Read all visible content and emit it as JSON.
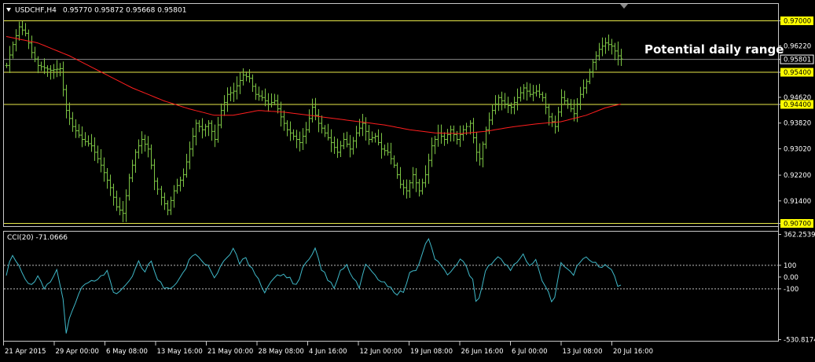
{
  "header": {
    "menu_icon": "triangle-down-icon",
    "symbol_timeframe": "USDCHF,H4",
    "ohlc": "0.95770 0.95872 0.95668 0.95801"
  },
  "annotation": "Potential daily range",
  "colors": {
    "background": "#000000",
    "candles": "#7cc444",
    "moving_average": "#ff1e1e",
    "level_lines": "#e8e84a",
    "level_label_bg": "#ffff00",
    "current_price_line": "#8a8a8a",
    "cci_line": "#3fb8c8",
    "frame": "#c8c8c8"
  },
  "chart_data": [
    {
      "type": "ohlc",
      "title": "USDCHF,H4",
      "ylim": [
        0.907,
        0.97
      ],
      "y_ticks": [
        "0.97000",
        "0.96220",
        "0.95801",
        "0.95400",
        "0.94620",
        "0.94400",
        "0.93820",
        "0.93020",
        "0.92200",
        "0.91400",
        "0.90700"
      ],
      "highlighted_levels": [
        {
          "label": "0.97000",
          "value": 0.97
        },
        {
          "label": "0.95400",
          "value": 0.954
        },
        {
          "label": "0.94400",
          "value": 0.944
        },
        {
          "label": "0.90700",
          "value": 0.907
        }
      ],
      "current_price": {
        "label": "0.95801",
        "value": 0.95801
      },
      "x_ticks": [
        "21 Apr 2015",
        "29 Apr 00:00",
        "6 May 08:00",
        "13 May 16:00",
        "21 May 00:00",
        "28 May 08:00",
        "4 Jun 16:00",
        "12 Jun 00:00",
        "19 Jun 08:00",
        "26 Jun 16:00",
        "6 Jul 00:00",
        "13 Jul 08:00",
        "20 Jul 16:00"
      ],
      "bar_count": 196,
      "close_anchors": [
        [
          0,
          0.956
        ],
        [
          2,
          0.9625
        ],
        [
          4,
          0.968
        ],
        [
          6,
          0.966
        ],
        [
          8,
          0.96
        ],
        [
          10,
          0.956
        ],
        [
          14,
          0.9545
        ],
        [
          17,
          0.955
        ],
        [
          19,
          0.942
        ],
        [
          21,
          0.937
        ],
        [
          24,
          0.933
        ],
        [
          27,
          0.931
        ],
        [
          30,
          0.925
        ],
        [
          33,
          0.918
        ],
        [
          35,
          0.912
        ],
        [
          37,
          0.91
        ],
        [
          39,
          0.921
        ],
        [
          41,
          0.929
        ],
        [
          43,
          0.933
        ],
        [
          45,
          0.93
        ],
        [
          47,
          0.92
        ],
        [
          49,
          0.915
        ],
        [
          51,
          0.911
        ],
        [
          53,
          0.917
        ],
        [
          56,
          0.922
        ],
        [
          58,
          0.93
        ],
        [
          60,
          0.938
        ],
        [
          62,
          0.936
        ],
        [
          64,
          0.938
        ],
        [
          66,
          0.933
        ],
        [
          68,
          0.942
        ],
        [
          70,
          0.947
        ],
        [
          72,
          0.948
        ],
        [
          75,
          0.953
        ],
        [
          77,
          0.952
        ],
        [
          79,
          0.947
        ],
        [
          81,
          0.946
        ],
        [
          83,
          0.944
        ],
        [
          85,
          0.945
        ],
        [
          87,
          0.94
        ],
        [
          89,
          0.936
        ],
        [
          91,
          0.934
        ],
        [
          93,
          0.932
        ],
        [
          95,
          0.936
        ],
        [
          97,
          0.943
        ],
        [
          99,
          0.938
        ],
        [
          101,
          0.935
        ],
        [
          103,
          0.932
        ],
        [
          105,
          0.929
        ],
        [
          107,
          0.933
        ],
        [
          109,
          0.93
        ],
        [
          111,
          0.935
        ],
        [
          113,
          0.938
        ],
        [
          115,
          0.933
        ],
        [
          117,
          0.934
        ],
        [
          119,
          0.93
        ],
        [
          121,
          0.929
        ],
        [
          123,
          0.925
        ],
        [
          125,
          0.919
        ],
        [
          127,
          0.917
        ],
        [
          129,
          0.922
        ],
        [
          131,
          0.917
        ],
        [
          133,
          0.922
        ],
        [
          135,
          0.931
        ],
        [
          137,
          0.935
        ],
        [
          139,
          0.933
        ],
        [
          141,
          0.936
        ],
        [
          143,
          0.933
        ],
        [
          145,
          0.936
        ],
        [
          147,
          0.938
        ],
        [
          149,
          0.929
        ],
        [
          150,
          0.927
        ],
        [
          152,
          0.936
        ],
        [
          154,
          0.942
        ],
        [
          156,
          0.946
        ],
        [
          158,
          0.944
        ],
        [
          160,
          0.943
        ],
        [
          162,
          0.946
        ],
        [
          164,
          0.949
        ],
        [
          166,
          0.947
        ],
        [
          168,
          0.948
        ],
        [
          170,
          0.946
        ],
        [
          172,
          0.94
        ],
        [
          174,
          0.937
        ],
        [
          176,
          0.946
        ],
        [
          178,
          0.944
        ],
        [
          180,
          0.941
        ],
        [
          182,
          0.947
        ],
        [
          184,
          0.951
        ],
        [
          186,
          0.957
        ],
        [
          188,
          0.961
        ],
        [
          190,
          0.963
        ],
        [
          192,
          0.962
        ],
        [
          194,
          0.959
        ],
        [
          195,
          0.95801
        ]
      ],
      "moving_average": [
        [
          0,
          0.965
        ],
        [
          10,
          0.963
        ],
        [
          20,
          0.959
        ],
        [
          30,
          0.954
        ],
        [
          40,
          0.949
        ],
        [
          50,
          0.945
        ],
        [
          58,
          0.9425
        ],
        [
          66,
          0.9405
        ],
        [
          72,
          0.9405
        ],
        [
          80,
          0.942
        ],
        [
          88,
          0.9415
        ],
        [
          96,
          0.9405
        ],
        [
          104,
          0.9395
        ],
        [
          112,
          0.9385
        ],
        [
          120,
          0.9375
        ],
        [
          128,
          0.936
        ],
        [
          136,
          0.935
        ],
        [
          144,
          0.9348
        ],
        [
          152,
          0.9355
        ],
        [
          160,
          0.9368
        ],
        [
          168,
          0.9378
        ],
        [
          176,
          0.9385
        ],
        [
          184,
          0.9405
        ],
        [
          190,
          0.9428
        ],
        [
          195,
          0.944
        ]
      ]
    },
    {
      "type": "line",
      "title": "CCI(20) -71.0666",
      "ylim": [
        -530.8174,
        362.2539
      ],
      "y_ticks": [
        "362.2539",
        "100",
        "0.00",
        "-100",
        "-530.8174"
      ],
      "reference_levels": [
        100,
        0,
        -100
      ],
      "series": [
        {
          "name": "CCI(20)",
          "points": [
            [
              0,
              30
            ],
            [
              2,
              200
            ],
            [
              4,
              100
            ],
            [
              6,
              -40
            ],
            [
              8,
              -80
            ],
            [
              10,
              20
            ],
            [
              12,
              -120
            ],
            [
              14,
              -40
            ],
            [
              16,
              60
            ],
            [
              18,
              -200
            ],
            [
              19,
              -480
            ],
            [
              20,
              -360
            ],
            [
              22,
              -200
            ],
            [
              24,
              -100
            ],
            [
              26,
              -60
            ],
            [
              28,
              -20
            ],
            [
              30,
              0
            ],
            [
              32,
              50
            ],
            [
              34,
              -120
            ],
            [
              36,
              -140
            ],
            [
              38,
              -60
            ],
            [
              40,
              20
            ],
            [
              42,
              120
            ],
            [
              44,
              60
            ],
            [
              46,
              150
            ],
            [
              48,
              -40
            ],
            [
              50,
              -80
            ],
            [
              52,
              -110
            ],
            [
              54,
              -40
            ],
            [
              56,
              40
            ],
            [
              58,
              130
            ],
            [
              60,
              200
            ],
            [
              62,
              120
            ],
            [
              64,
              80
            ],
            [
              66,
              -10
            ],
            [
              68,
              80
            ],
            [
              70,
              150
            ],
            [
              72,
              240
            ],
            [
              74,
              120
            ],
            [
              76,
              160
            ],
            [
              78,
              60
            ],
            [
              80,
              -20
            ],
            [
              82,
              -120
            ],
            [
              84,
              -60
            ],
            [
              86,
              0
            ],
            [
              88,
              40
            ],
            [
              90,
              -20
            ],
            [
              92,
              -80
            ],
            [
              94,
              60
            ],
            [
              96,
              140
            ],
            [
              98,
              240
            ],
            [
              100,
              60
            ],
            [
              102,
              -20
            ],
            [
              104,
              -100
            ],
            [
              106,
              40
            ],
            [
              108,
              100
            ],
            [
              110,
              0
            ],
            [
              112,
              -80
            ],
            [
              114,
              120
            ],
            [
              116,
              60
            ],
            [
              118,
              -40
            ],
            [
              120,
              -60
            ],
            [
              122,
              -80
            ],
            [
              124,
              -150
            ],
            [
              126,
              -120
            ],
            [
              128,
              20
            ],
            [
              130,
              60
            ],
            [
              132,
              200
            ],
            [
              134,
              340
            ],
            [
              136,
              150
            ],
            [
              138,
              80
            ],
            [
              140,
              30
            ],
            [
              142,
              80
            ],
            [
              144,
              150
            ],
            [
              146,
              70
            ],
            [
              148,
              -30
            ],
            [
              149,
              -200
            ],
            [
              150,
              -180
            ],
            [
              152,
              40
            ],
            [
              154,
              120
            ],
            [
              156,
              180
            ],
            [
              158,
              100
            ],
            [
              160,
              60
            ],
            [
              162,
              140
            ],
            [
              164,
              200
            ],
            [
              166,
              80
            ],
            [
              168,
              150
            ],
            [
              170,
              -20
            ],
            [
              172,
              -120
            ],
            [
              173,
              -230
            ],
            [
              174,
              -160
            ],
            [
              176,
              100
            ],
            [
              178,
              80
            ],
            [
              180,
              20
            ],
            [
              182,
              120
            ],
            [
              184,
              160
            ],
            [
              186,
              120
            ],
            [
              188,
              90
            ],
            [
              190,
              100
            ],
            [
              192,
              60
            ],
            [
              194,
              -70
            ],
            [
              195,
              -71.0666
            ]
          ]
        }
      ]
    }
  ]
}
